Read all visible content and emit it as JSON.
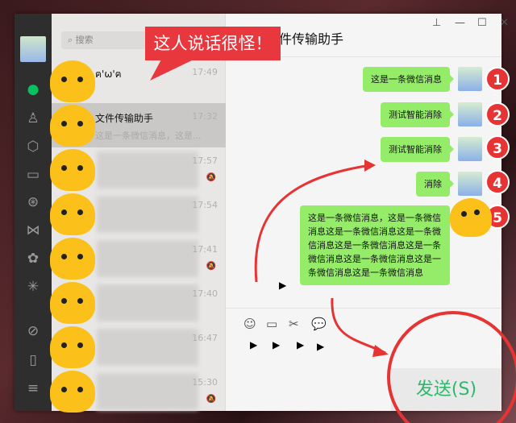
{
  "window": {
    "title": "文件传输助手",
    "controls": [
      "pin",
      "minimize",
      "maximize",
      "close"
    ]
  },
  "search": {
    "placeholder": "搜索"
  },
  "sidebar": [
    "chat",
    "contacts",
    "collections",
    "files",
    "moments",
    "channels",
    "search",
    "top-stories",
    "mini-programs",
    "phone",
    "menu"
  ],
  "chats": [
    {
      "name": "ฅ'ω'ฅ",
      "preview": "",
      "time": "17:49",
      "muted": false
    },
    {
      "name": "文件传输助手",
      "preview": "这是一条微信消息，这是...",
      "time": "17:32",
      "muted": false
    },
    {
      "name": "",
      "preview": "",
      "time": "17:57",
      "muted": true
    },
    {
      "name": "",
      "preview": "",
      "time": "17:54",
      "muted": false
    },
    {
      "name": "",
      "preview": "",
      "time": "17:41",
      "muted": true
    },
    {
      "name": "",
      "preview": "",
      "time": "17:40",
      "muted": false
    },
    {
      "name": "",
      "preview": "",
      "time": "16:47",
      "muted": false
    },
    {
      "name": "",
      "preview": "",
      "time": "15:30",
      "muted": true
    }
  ],
  "messages": [
    {
      "text": "这是一条微信消息",
      "badge": "1"
    },
    {
      "text": "测试智能消除",
      "badge": "2"
    },
    {
      "text": "测试智能消除",
      "badge": "3"
    },
    {
      "text": "消除",
      "badge": "4"
    },
    {
      "text": "这是一条微信消息，这是一条微信消息这是一条微信消息这是一条微信消息这是一条微信消息这是一条微信消息这是一条微信消息这是一条微信消息这是一条微信消息",
      "badge": "5"
    }
  ],
  "toolbar": [
    "emoji",
    "file",
    "screenshot",
    "chat-history"
  ],
  "send_label": "发送(S)",
  "annotation": {
    "callout": "这人说话很怪！"
  },
  "colors": {
    "bubble": "#95ec69",
    "accent": "#07c160",
    "annotation": "#e63434"
  }
}
